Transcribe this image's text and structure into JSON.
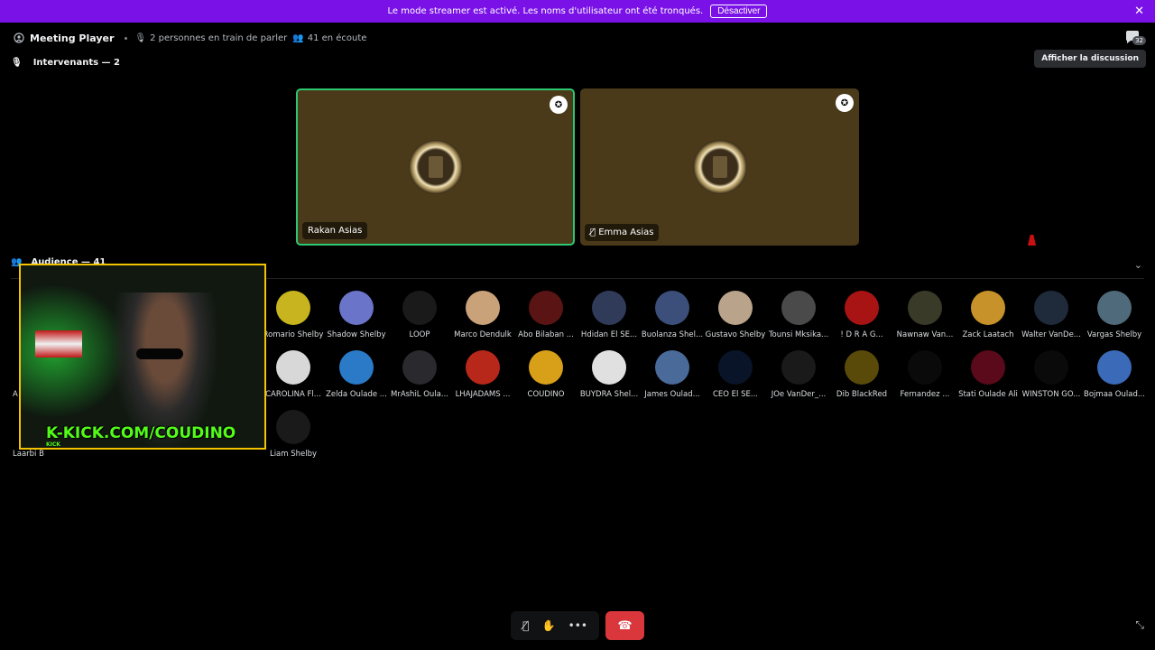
{
  "banner": {
    "text": "Le mode streamer est activé. Les noms d'utilisateur ont été tronqués.",
    "button": "Désactiver"
  },
  "header": {
    "title": "Meeting Player",
    "speaking": "2 personnes en train de parler",
    "listening": "41 en écoute",
    "chat_badge": "32",
    "tooltip": "Afficher la discussion"
  },
  "speakers": {
    "label": "Intervenants — 2",
    "tiles": [
      {
        "name": "Rakan Asias"
      },
      {
        "name": "Emma Asias"
      }
    ]
  },
  "audience": {
    "label": "Audience — 41",
    "row1": [
      {
        "name": "Romario Shelby",
        "color": "#c8b41e"
      },
      {
        "name": "Shadow Shelby",
        "color": "#6a74c9"
      },
      {
        "name": "LOOP",
        "color": "#1a1a1a"
      },
      {
        "name": "Marco Dendulk",
        "color": "#c9a27a"
      },
      {
        "name": "Abo Bilaban ...",
        "color": "#5a1414"
      },
      {
        "name": "Hdidan El SE...",
        "color": "#2f3b58"
      },
      {
        "name": "Buolanza Shel...",
        "color": "#3b4f7a"
      },
      {
        "name": "Gustavo Shelby",
        "color": "#b9a38a"
      },
      {
        "name": "Tounsi Mksika...",
        "color": "#4a4a4a"
      },
      {
        "name": "! D R A G...",
        "color": "#a81414"
      },
      {
        "name": "Nawnaw Van...",
        "color": "#3a3a28"
      },
      {
        "name": "Zack Laatach",
        "color": "#c8922a"
      },
      {
        "name": "Walter VanDe...",
        "color": "#1f2a3a"
      },
      {
        "name": "Vargas Shelby",
        "color": "#4f6a7a"
      }
    ],
    "row2": [
      {
        "name": "CAROLINA Fl...",
        "color": "#d8d8d8"
      },
      {
        "name": "Zelda Oulade ...",
        "color": "#2a7ac8"
      },
      {
        "name": "MrAshiL Oula...",
        "color": "#2a2a2e"
      },
      {
        "name": "LHAJADAMS ...",
        "color": "#b8281a"
      },
      {
        "name": "COUDINO",
        "color": "#d8a018"
      },
      {
        "name": "BUYDRA Shel...",
        "color": "#e0e0e0"
      },
      {
        "name": "James Oulad...",
        "color": "#4a6a9a"
      },
      {
        "name": "CEO El SE...",
        "color": "#0a1428"
      },
      {
        "name": "JOe VanDer_...",
        "color": "#1a1a1a"
      },
      {
        "name": "Dib BlackRed",
        "color": "#5a4a0a"
      },
      {
        "name": "Fernandez ...",
        "color": "#0a0a0a"
      },
      {
        "name": "Stati Oulade Ali",
        "color": "#5a0a1a"
      },
      {
        "name": "WINSTON GO...",
        "color": "#0a0a0a"
      },
      {
        "name": "Bojmaa Oulad...",
        "color": "#3a6ab8"
      }
    ],
    "row3": [
      {
        "name": "Liam Shelby",
        "color": "#1a1a1a"
      }
    ],
    "partial_left": "A",
    "partial_bottom": "Laarbi B"
  },
  "webcam": {
    "overlay_text": "K-KICK.COM/COUDINO",
    "overlay_small": "KICK"
  },
  "colors": {
    "banner": "#7a12e8",
    "speaking_border": "#2dc770",
    "hangup": "#da373c",
    "webcam_border": "#f3c300"
  }
}
